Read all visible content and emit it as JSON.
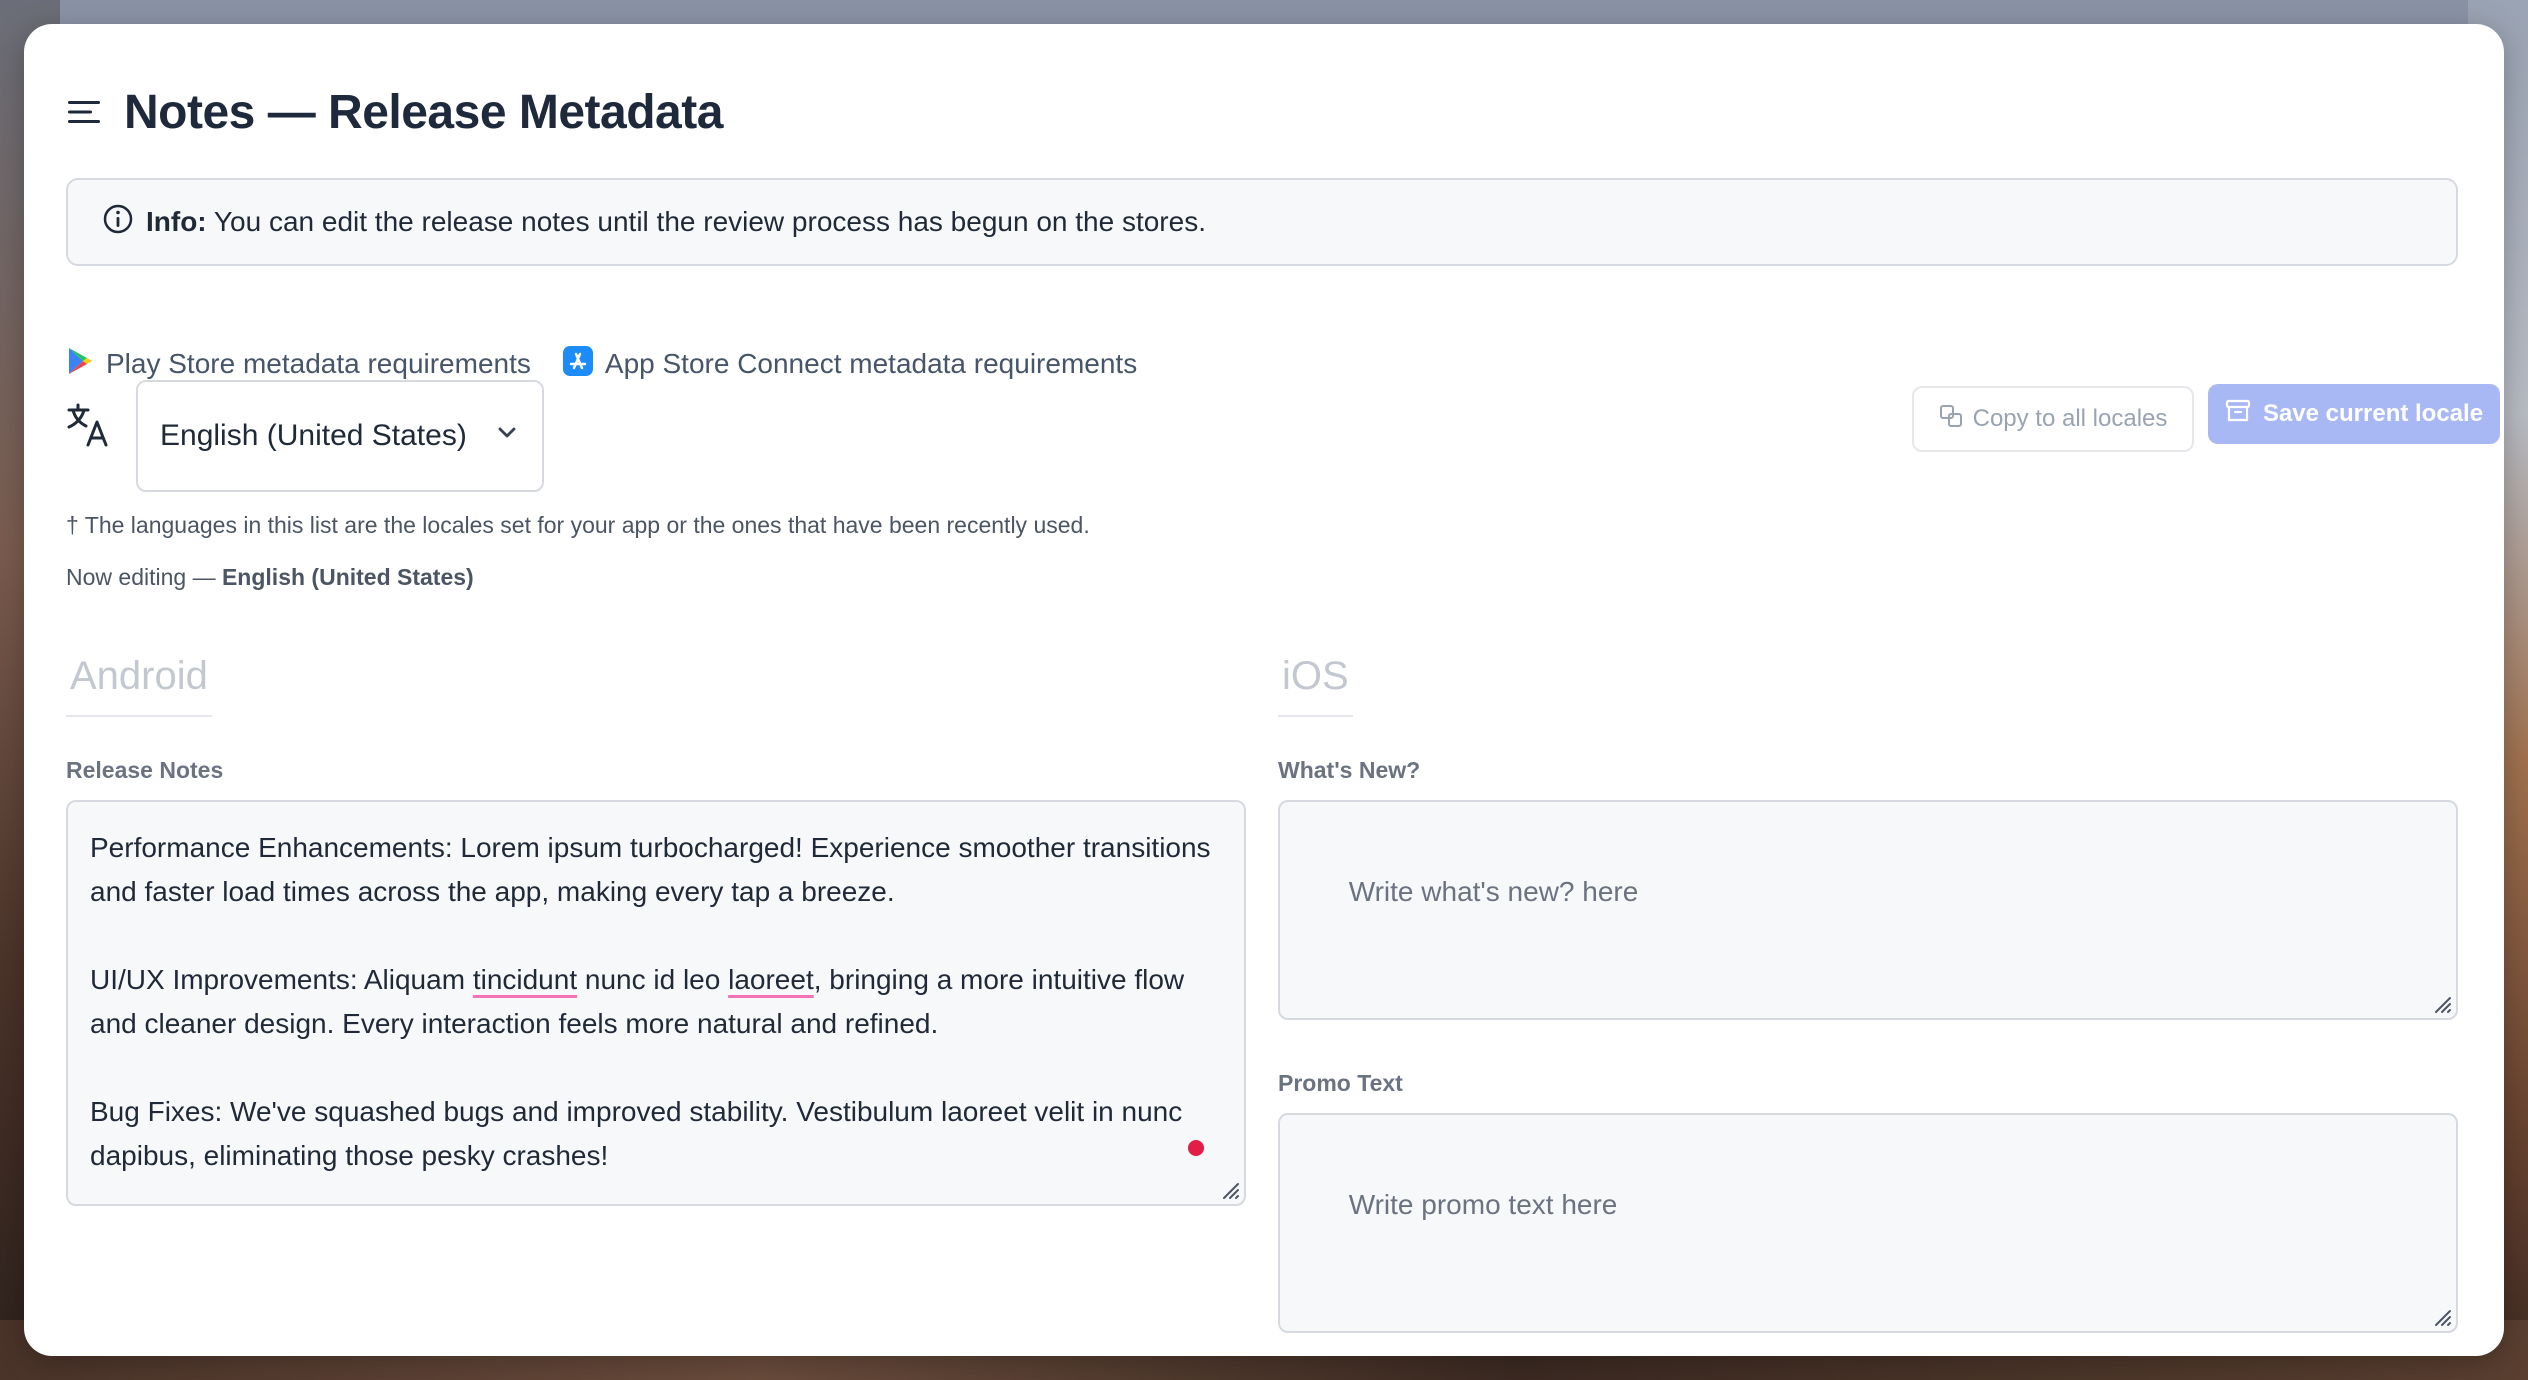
{
  "window": {
    "title": "Notes — Release Metadata"
  },
  "info": {
    "label": "Info:",
    "text": "You can edit the release notes until the review process has begun on the stores."
  },
  "links": {
    "play_store": "Play Store metadata requirements",
    "app_store": "App Store Connect metadata requirements"
  },
  "locale": {
    "selected": "English (United States)",
    "copy_button": "Copy to all locales",
    "save_button": "Save current locale",
    "footnote": "† The languages in this list are the locales set for your app or the ones that have been recently used.",
    "now_editing_prefix": "Now editing —",
    "now_editing_value": "English (United States)"
  },
  "android": {
    "title": "Android",
    "release_notes_label": "Release Notes",
    "release_notes": {
      "p1": "Performance Enhancements: Lorem ipsum turbocharged! Experience smoother transitions and faster load times across the app, making every tap a breeze.",
      "p2_a": "UI/UX Improvements: Aliquam ",
      "p2_b": "tincidunt",
      "p2_c": " nunc id leo ",
      "p2_d": "laoreet",
      "p2_e": ", bringing a more intuitive flow and cleaner design. Every interaction feels more natural and refined.",
      "p3": "Bug Fixes: We've squashed bugs and improved stability. Vestibulum laoreet velit in nunc dapibus, eliminating those pesky crashes!"
    }
  },
  "ios": {
    "title": "iOS",
    "whats_new_label": "What's New?",
    "whats_new_placeholder": "Write what's new? here",
    "promo_label": "Promo Text",
    "promo_placeholder": "Write promo text here"
  },
  "colors": {
    "save_button": "#a8b8f4",
    "spell_underline": "#f472b6",
    "unsaved_dot": "#e11d48"
  }
}
